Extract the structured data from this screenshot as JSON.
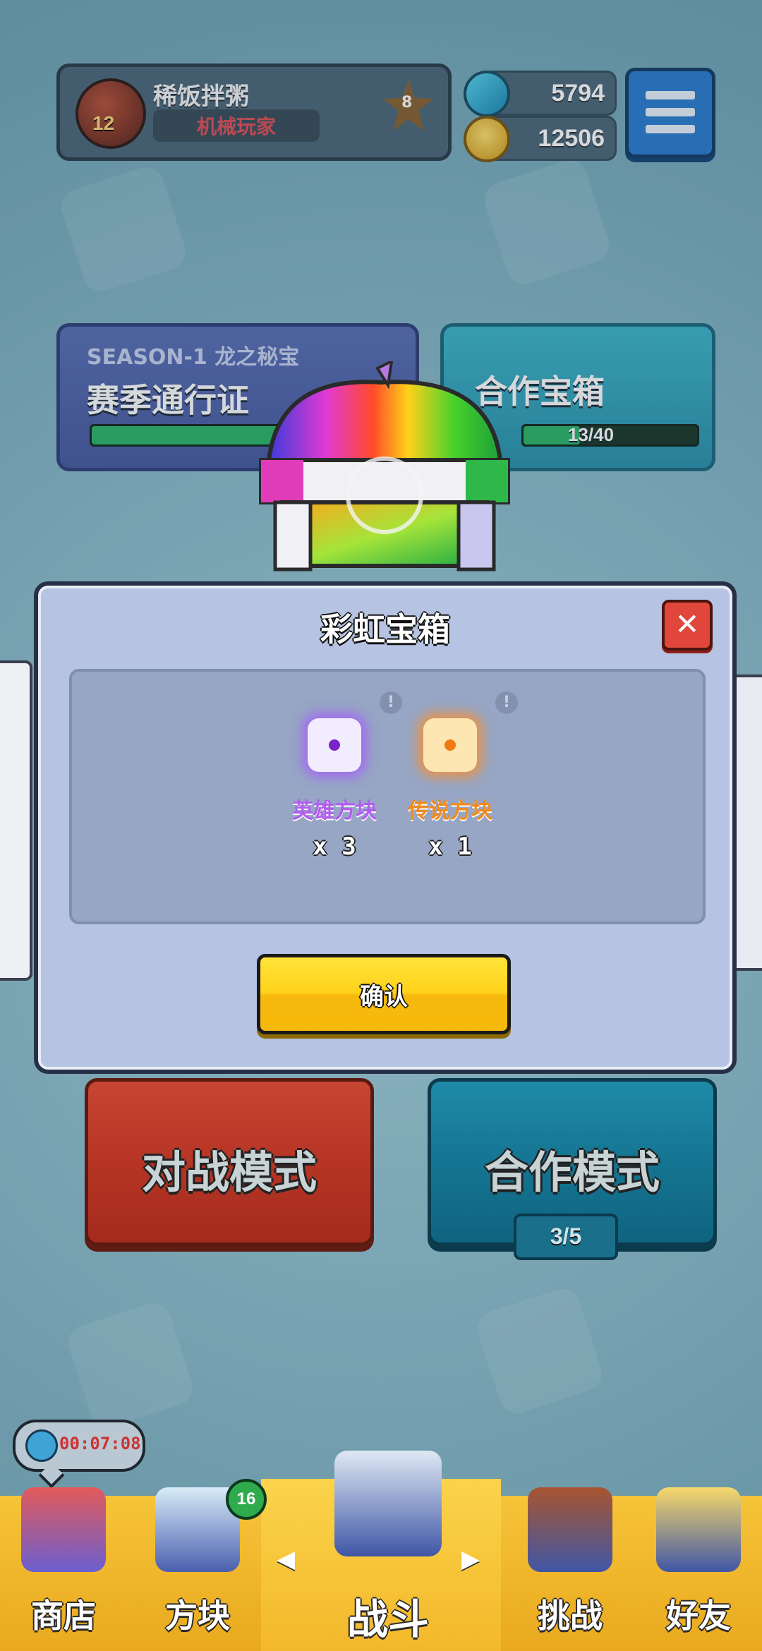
{
  "profile": {
    "name": "稀饭拌粥",
    "title": "机械玩家",
    "level": "12",
    "rank": "8"
  },
  "currency": {
    "gems": "5794",
    "coins": "12506"
  },
  "cards": {
    "season_label": "SEASON-1 龙之秘宝",
    "season_title": "赛季通行证",
    "coop_title": "合作宝箱",
    "coop_progress": "13/40",
    "coop_progress_value": 0.325
  },
  "modal": {
    "title": "彩虹宝箱",
    "close_icon": "close-icon",
    "rewards": [
      {
        "name": "英雄方块",
        "count": "x 3",
        "color": "#b25cf0"
      },
      {
        "name": "传说方块",
        "count": "x 1",
        "color": "#f28a1c"
      }
    ],
    "confirm_label": "确认"
  },
  "modes": {
    "battle_label": "对战模式",
    "coop_label": "合作模式",
    "coop_count": "3/5"
  },
  "timer": {
    "value": "00:07:08"
  },
  "nav": {
    "items": [
      {
        "label": "商店",
        "icon": "shop-icon"
      },
      {
        "label": "方块",
        "icon": "dice-icon",
        "badge": "16"
      },
      {
        "label": "战斗",
        "icon": "battle-icon"
      },
      {
        "label": "挑战",
        "icon": "challenge-icon"
      },
      {
        "label": "好友",
        "icon": "friend-icon"
      }
    ]
  },
  "colors": {
    "accent_yellow": "#ffd21a",
    "danger_red": "#e0473a",
    "panel": "#b6c3e3"
  }
}
